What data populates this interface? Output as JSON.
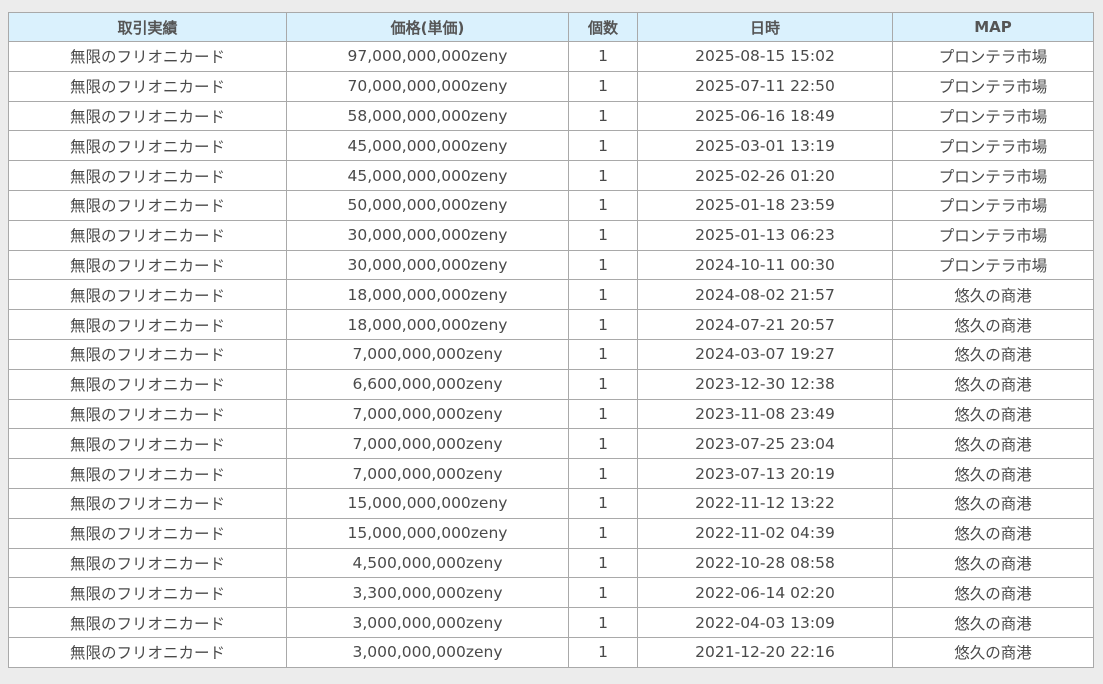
{
  "table": {
    "headers": [
      "取引実績",
      "価格(単価)",
      "個数",
      "日時",
      "MAP"
    ],
    "rows": [
      [
        "無限のフリオニカード",
        "97,000,000,000zeny",
        "1",
        "2025-08-15 15:02",
        "プロンテラ市場"
      ],
      [
        "無限のフリオニカード",
        "70,000,000,000zeny",
        "1",
        "2025-07-11 22:50",
        "プロンテラ市場"
      ],
      [
        "無限のフリオニカード",
        "58,000,000,000zeny",
        "1",
        "2025-06-16 18:49",
        "プロンテラ市場"
      ],
      [
        "無限のフリオニカード",
        "45,000,000,000zeny",
        "1",
        "2025-03-01 13:19",
        "プロンテラ市場"
      ],
      [
        "無限のフリオニカード",
        "45,000,000,000zeny",
        "1",
        "2025-02-26 01:20",
        "プロンテラ市場"
      ],
      [
        "無限のフリオニカード",
        "50,000,000,000zeny",
        "1",
        "2025-01-18 23:59",
        "プロンテラ市場"
      ],
      [
        "無限のフリオニカード",
        "30,000,000,000zeny",
        "1",
        "2025-01-13 06:23",
        "プロンテラ市場"
      ],
      [
        "無限のフリオニカード",
        "30,000,000,000zeny",
        "1",
        "2024-10-11 00:30",
        "プロンテラ市場"
      ],
      [
        "無限のフリオニカード",
        "18,000,000,000zeny",
        "1",
        "2024-08-02 21:57",
        "悠久の商港"
      ],
      [
        "無限のフリオニカード",
        "18,000,000,000zeny",
        "1",
        "2024-07-21 20:57",
        "悠久の商港"
      ],
      [
        "無限のフリオニカード",
        "7,000,000,000zeny",
        "1",
        "2024-03-07 19:27",
        "悠久の商港"
      ],
      [
        "無限のフリオニカード",
        "6,600,000,000zeny",
        "1",
        "2023-12-30 12:38",
        "悠久の商港"
      ],
      [
        "無限のフリオニカード",
        "7,000,000,000zeny",
        "1",
        "2023-11-08 23:49",
        "悠久の商港"
      ],
      [
        "無限のフリオニカード",
        "7,000,000,000zeny",
        "1",
        "2023-07-25 23:04",
        "悠久の商港"
      ],
      [
        "無限のフリオニカード",
        "7,000,000,000zeny",
        "1",
        "2023-07-13 20:19",
        "悠久の商港"
      ],
      [
        "無限のフリオニカード",
        "15,000,000,000zeny",
        "1",
        "2022-11-12 13:22",
        "悠久の商港"
      ],
      [
        "無限のフリオニカード",
        "15,000,000,000zeny",
        "1",
        "2022-11-02 04:39",
        "悠久の商港"
      ],
      [
        "無限のフリオニカード",
        "4,500,000,000zeny",
        "1",
        "2022-10-28 08:58",
        "悠久の商港"
      ],
      [
        "無限のフリオニカード",
        "3,300,000,000zeny",
        "1",
        "2022-06-14 02:20",
        "悠久の商港"
      ],
      [
        "無限のフリオニカード",
        "3,000,000,000zeny",
        "1",
        "2022-04-03 13:09",
        "悠久の商港"
      ],
      [
        "無限のフリオニカード",
        "3,000,000,000zeny",
        "1",
        "2021-12-20 22:16",
        "悠久の商港"
      ]
    ]
  },
  "colors": {
    "header_bg": "#daf1fd",
    "border": "#a9a9a9",
    "page_bg": "#ececec"
  }
}
